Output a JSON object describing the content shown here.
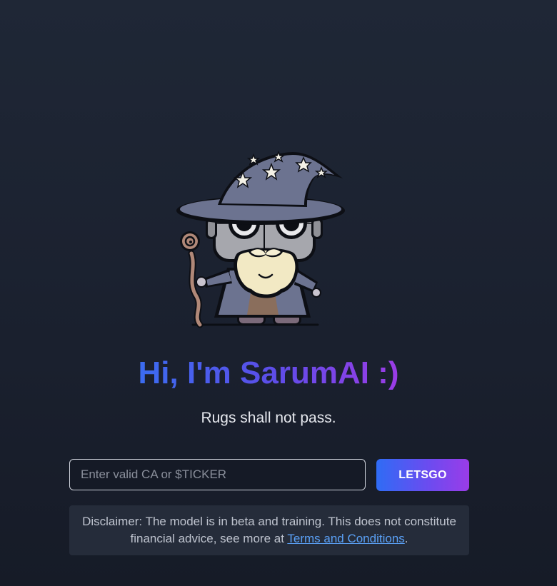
{
  "hero": {
    "title": "Hi, I'm SarumAI :)",
    "tagline": "Rugs shall not pass."
  },
  "search": {
    "placeholder": "Enter valid CA or $TICKER",
    "value": "",
    "button_label": "LETSGO"
  },
  "disclaimer": {
    "text": "Disclaimer: The model is in beta and training. This does not constitute financial advice, see more at ",
    "link_text": "Terms and Conditions",
    "suffix": "."
  },
  "mascot": {
    "icon": "robot-wizard-mascot"
  },
  "colors": {
    "background": "#1d2433",
    "accent_start": "#3b6cf0",
    "accent_end": "#9b3ce6",
    "link": "#5aa0f5"
  }
}
